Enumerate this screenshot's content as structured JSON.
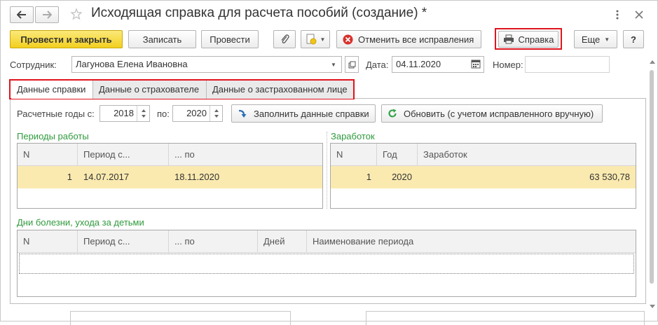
{
  "window": {
    "title": "Исходящая справка для расчета пособий (создание) *"
  },
  "toolbar": {
    "post_close": "Провести и закрыть",
    "save": "Записать",
    "post": "Провести",
    "cancel_fixes": "Отменить все исправления",
    "report": "Справка",
    "more": "Еще",
    "help": "?"
  },
  "header": {
    "employee_label": "Сотрудник:",
    "employee_value": "Лагунова Елена Ивановна",
    "date_label": "Дата:",
    "date_value": "04.11.2020",
    "number_label": "Номер:",
    "number_value": ""
  },
  "tabs": [
    {
      "label": "Данные справки"
    },
    {
      "label": "Данные о страхователе"
    },
    {
      "label": "Данные о застрахованном лице"
    }
  ],
  "years": {
    "from_label": "Расчетные годы с:",
    "from_value": "2018",
    "to_label": "по:",
    "to_value": "2020",
    "fill_button": "Заполнить данные справки",
    "refresh_button": "Обновить (с учетом исправленного вручную)"
  },
  "work_periods": {
    "title": "Периоды работы",
    "columns": [
      "N",
      "Период с...",
      "... по"
    ],
    "rows": [
      [
        "1",
        "14.07.2017",
        "18.11.2020"
      ]
    ]
  },
  "earnings": {
    "title": "Заработок",
    "columns": [
      "N",
      "Год",
      "Заработок"
    ],
    "rows": [
      [
        "1",
        "2020",
        "63 530,78"
      ]
    ]
  },
  "sick_days": {
    "title": "Дни болезни, ухода за детьми",
    "columns": [
      "N",
      "Период с...",
      "... по",
      "Дней",
      "Наименование периода"
    ]
  },
  "colors": {
    "accent_yellow": "#f2cf1f",
    "highlight_red": "#e0141e",
    "section_green": "#2f9a3c",
    "selected_row": "#fbeab0"
  }
}
